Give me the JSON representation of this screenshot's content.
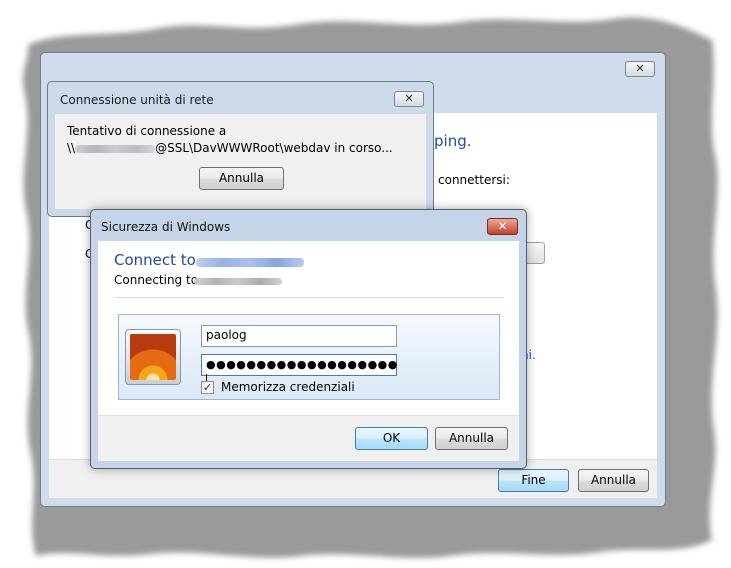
{
  "main_window": {
    "close_label": "✕",
    "heading_fragment": "ping.",
    "text_fragment": "connettersi:",
    "link_fragment": "ni.",
    "left_fragment_1": "C",
    "left_fragment_2": "C",
    "finish_label": "Fine",
    "cancel_label": "Annulla"
  },
  "connecting_dialog": {
    "title": "Connessione unità di rete",
    "close_label": "✕",
    "message_line1": "Tentativo di connessione a",
    "message_prefix": "\\\\",
    "message_suffix": "@SSL\\DavWWWRoot\\webdav in corso...",
    "cancel_label": "Annulla"
  },
  "security_dialog": {
    "title": "Sicurezza di Windows",
    "close_label": "✕",
    "heading": "Connect to",
    "subheading": "Connecting to",
    "username": "paolog",
    "password_masked": "●●●●●●●●●●●●●●●●●●●",
    "remember_checked": "✓",
    "remember_label": "Memorizza credenziali",
    "ok_label": "OK",
    "cancel_label": "Annulla"
  }
}
